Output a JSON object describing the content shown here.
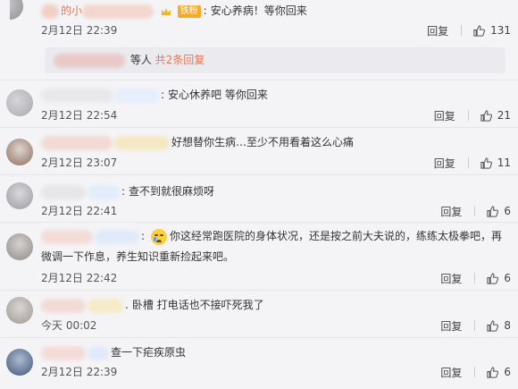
{
  "colors": {
    "accent": "#eb7350",
    "fans_badge": "#f7a928",
    "background": "#f4f4f6"
  },
  "comments": [
    {
      "username_tail": "的小",
      "fans_badge": "铁粉",
      "text": "安心养病！等你回来",
      "date": "2月12日 22:39",
      "reply": "回复",
      "likes": "131",
      "sub_text": "等人",
      "sub_link": "共2条回复"
    },
    {
      "text": "安心休养吧 等你回来",
      "date": "2月12日 22:54",
      "reply": "回复",
      "likes": "21"
    },
    {
      "text": "好想替你生病…至少不用看着这么心痛",
      "date": "2月12日 23:07",
      "reply": "回复",
      "likes": "11"
    },
    {
      "text": "查不到就很麻烦呀",
      "date": "2月12日 22:41",
      "reply": "回复",
      "likes": "6"
    },
    {
      "text": "你这经常跑医院的身体状况，还是按之前大夫说的，练练太极拳吧，再微调一下作息，养生知识重新捡起来吧。",
      "date": "2月12日 22:42",
      "reply": "回复",
      "likes": "6"
    },
    {
      "text": "卧槽 打电话也不接吓死我了",
      "date": "今天 00:02",
      "reply": "回复",
      "likes": "8"
    },
    {
      "text": "查一下疟疾原虫",
      "date": "2月12日 22:39",
      "reply": "回复",
      "likes": "6"
    }
  ],
  "icons": {
    "like": "thumbs-up-icon",
    "emoji": "crying-face-emoji-icon",
    "crown": "crown-icon"
  }
}
